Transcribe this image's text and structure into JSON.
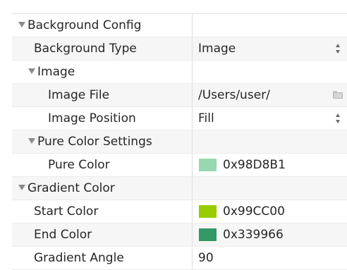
{
  "properties": {
    "background_config": {
      "label": "Background Config"
    },
    "background_type": {
      "label": "Background Type",
      "value": "Image"
    },
    "image": {
      "label": "Image"
    },
    "image_file": {
      "label": "Image File",
      "value": "/Users/user/",
      "icon": "folder-icon"
    },
    "image_position": {
      "label": "Image Position",
      "value": "Fill"
    },
    "pure_color_settings": {
      "label": "Pure Color Settings"
    },
    "pure_color": {
      "label": "Pure Color",
      "value": "0x98D8B1",
      "swatch": "#98D8B1"
    },
    "gradient_color": {
      "label": "Gradient Color"
    },
    "start_color": {
      "label": "Start Color",
      "value": "0x99CC00",
      "swatch": "#99CC00"
    },
    "end_color": {
      "label": "End Color",
      "value": "0x339966",
      "swatch": "#339966"
    },
    "gradient_angle": {
      "label": "Gradient Angle",
      "value": "90"
    }
  },
  "colors": {
    "disclosure_triangle": "#8a8a8a",
    "row_alt_background": "#f6f6f6",
    "grid_line": "#ebebeb"
  }
}
